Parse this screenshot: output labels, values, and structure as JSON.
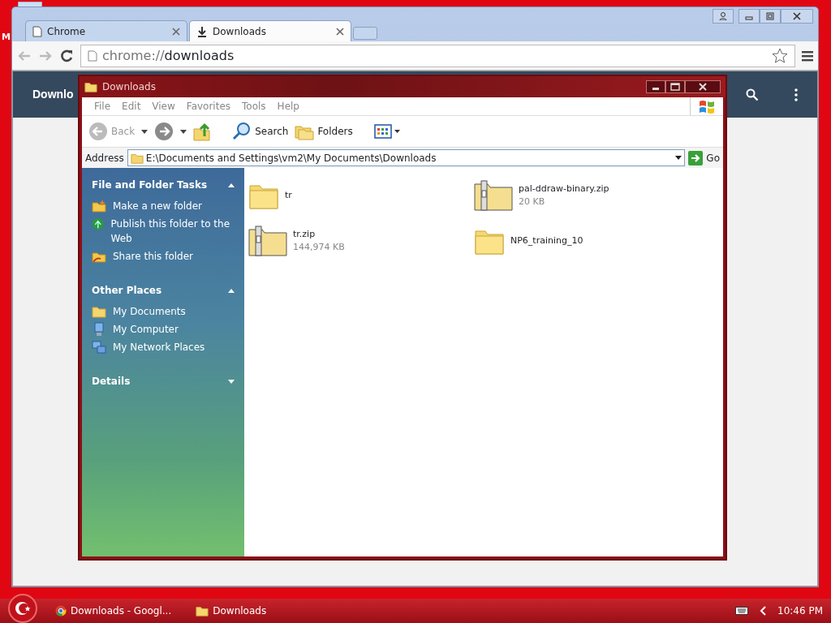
{
  "desktop": {
    "icon_label": "M"
  },
  "chrome": {
    "tabs": [
      {
        "label": "Chrome",
        "selected": false
      },
      {
        "label": "Downloads",
        "selected": true
      }
    ],
    "address": {
      "scheme": "chrome://",
      "path": "downloads"
    },
    "page_header": {
      "title": "Downlo"
    }
  },
  "explorer": {
    "title": "Downloads",
    "menu": [
      "File",
      "Edit",
      "View",
      "Favorites",
      "Tools",
      "Help"
    ],
    "toolbar": [
      {
        "kind": "back",
        "label": "Back",
        "disabled": true
      },
      {
        "kind": "forward"
      },
      {
        "kind": "up"
      },
      {
        "kind": "search",
        "label": "Search"
      },
      {
        "kind": "folders",
        "label": "Folders"
      },
      {
        "kind": "views"
      }
    ],
    "address": {
      "label": "Address",
      "value": "E:\\Documents and Settings\\vm2\\My Documents\\Downloads",
      "go": "Go"
    },
    "sidebar": [
      {
        "title": "File and Folder Tasks",
        "expanded": true,
        "items": [
          {
            "label": "Make a new folder"
          },
          {
            "label": "Publish this folder to the Web"
          },
          {
            "label": "Share this folder"
          }
        ]
      },
      {
        "title": "Other Places",
        "expanded": true,
        "items": [
          {
            "label": "My Documents"
          },
          {
            "label": "My Computer"
          },
          {
            "label": "My Network Places"
          }
        ]
      },
      {
        "title": "Details",
        "expanded": false
      }
    ],
    "files": [
      {
        "name": "tr",
        "kind": "folder"
      },
      {
        "name": "pal-ddraw-binary.zip",
        "kind": "zip",
        "size": "20 KB"
      },
      {
        "name": "tr.zip",
        "kind": "zip",
        "size": "144,974 KB"
      },
      {
        "name": "NP6_training_10",
        "kind": "folder"
      }
    ]
  },
  "taskbar": {
    "items": [
      {
        "label": "Downloads - Googl..."
      },
      {
        "label": "Downloads"
      }
    ],
    "clock": "10:46 PM"
  }
}
